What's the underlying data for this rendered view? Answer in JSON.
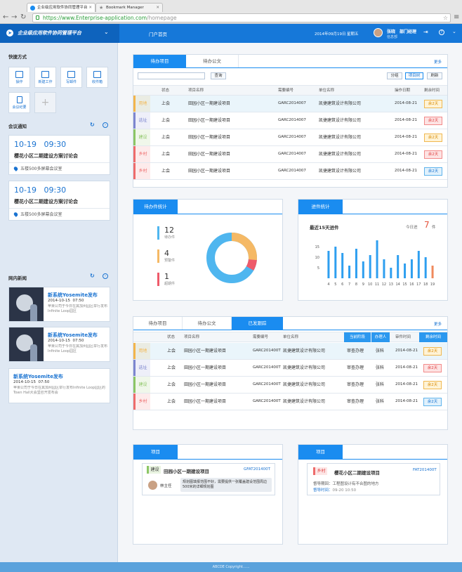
{
  "browser": {
    "tabs": [
      {
        "title": "企业级应用软件协同管理平台",
        "active": true
      },
      {
        "title": "Bookmark Manager",
        "active": false
      }
    ],
    "url_host": "https://www.Enterprise-application.com",
    "url_path": "/homepage"
  },
  "topbar": {
    "app_title": "企业级应用软件协同管理平台",
    "nav_home": "门户首页",
    "date": "2014年09月19日",
    "weekday": "星期五",
    "user_name": "张晓",
    "user_role": "部门经理",
    "user_dept": "信息部"
  },
  "sidebar": {
    "quick_title": "快捷方式",
    "quick": [
      {
        "label": "操作",
        "icon": "monitor-icon"
      },
      {
        "label": "新建工作",
        "icon": "new-doc-icon"
      },
      {
        "label": "写邮件",
        "icon": "mail-icon"
      },
      {
        "label": "收件箱",
        "icon": "inbox-icon"
      },
      {
        "label": "会议纪要",
        "icon": "notes-icon"
      }
    ],
    "meeting_title": "会议通知",
    "meetings": [
      {
        "date": "10-19",
        "time": "09:30",
        "name": "樱花小区二期建设方案讨论会",
        "location": "五楼500多屏幕会议室"
      },
      {
        "date": "10-19",
        "time": "09:30",
        "name": "樱花小区二期建设方案讨论会",
        "location": "五楼500多屏幕会议室"
      }
    ],
    "news_title": "网内新闻",
    "news": [
      {
        "title": "新系统Yosemite发布",
        "date": "2014-10-15",
        "time": "07:50",
        "text": "苹果公司于今日在其加州园区举行发布Infinite Loop园区"
      },
      {
        "title": "新系统Yosemite发布",
        "date": "2014-10-15",
        "time": "07:50",
        "text": "苹果公司于今日在其加州园区举行发布Infinite Loop园区"
      },
      {
        "title": "新系统Yosemite发布",
        "date": "2014-10-15",
        "time": "07:50",
        "text": "苹果公司于今日在其加州园区举行发布Infinite Loop园区的Town Hall大会堂召开发布会"
      }
    ]
  },
  "todo": {
    "tabs": [
      "待办项目",
      "待办公文"
    ],
    "more": "更多",
    "search_btn": "查询",
    "buttons": [
      "分组",
      "项目树",
      "刷新"
    ],
    "headers": [
      "状态",
      "项目名称",
      "需要编号",
      "单位名称",
      "操作日期",
      "剩余时间"
    ],
    "rows": [
      {
        "tag": "用地",
        "tag_color": "#f3b54a",
        "status": "上会",
        "project": "田园小区一期建设项目",
        "code": "GARC2014007",
        "company": "凯捷建筑设计有限公司",
        "date": "2014-08-21",
        "remain": "余2天",
        "remain_type": "yellow"
      },
      {
        "tag": "选址",
        "tag_color": "#7d86cf",
        "status": "上会",
        "project": "田园小区一期建设项目",
        "code": "GARC2014007",
        "company": "凯捷建筑设计有限公司",
        "date": "2014-08-21",
        "remain": "余2天",
        "remain_type": "red"
      },
      {
        "tag": "建设",
        "tag_color": "#8cc665",
        "status": "上会",
        "project": "田园小区一期建设项目",
        "code": "GARC2014007",
        "company": "凯捷建筑设计有限公司",
        "date": "2014-08-21",
        "remain": "余2天",
        "remain_type": "yellow"
      },
      {
        "tag": "乡村",
        "tag_color": "#ee6b6b",
        "status": "上会",
        "project": "田园小区一期建设项目",
        "code": "GARC2014007",
        "company": "凯捷建筑设计有限公司",
        "date": "2014-08-21",
        "remain": "余2天",
        "remain_type": "red"
      },
      {
        "tag": "乡村",
        "tag_color": "#ee6b6b",
        "status": "上会",
        "project": "田园小区一期建设项目",
        "code": "GARC2014007",
        "company": "凯捷建筑设计有限公司",
        "date": "2014-08-21",
        "remain": "余2天",
        "remain_type": "blue"
      }
    ]
  },
  "stats": {
    "title": "待办件统计",
    "items": [
      {
        "num": "12",
        "label": "待办件",
        "color": "#4fb6ef"
      },
      {
        "num": "4",
        "label": "预警件",
        "color": "#f5b965"
      },
      {
        "num": "1",
        "label": "超期件",
        "color": "#ee5a6a"
      }
    ],
    "colors": {
      "ring_blue": "#4fb6ef",
      "ring_yellow": "#f5b965",
      "ring_red": "#ee5a6a"
    }
  },
  "progress": {
    "title": "进件统计",
    "subtitle": "最近15天进件",
    "today_label": "今日进",
    "today_num": "7",
    "today_unit": "件"
  },
  "chart_data": {
    "type": "bar",
    "title": "最近15天进件",
    "categories": [
      "4",
      "5",
      "6",
      "7",
      "8",
      "9",
      "10",
      "11",
      "12",
      "13",
      "14",
      "15",
      "16",
      "17",
      "18",
      "19"
    ],
    "values": [
      13,
      15,
      12,
      6,
      14,
      8,
      11,
      18,
      9,
      5,
      11,
      7,
      9,
      13,
      10,
      6
    ],
    "highlight_last": true,
    "ylim": [
      0,
      20
    ],
    "yticks": [
      5,
      10,
      15
    ],
    "colors": {
      "bar": "#2e9ff0",
      "last": "#f08a5d"
    }
  },
  "tracking": {
    "tabs": [
      "待办项目",
      "待办公文",
      "已发跟踪"
    ],
    "more": "更多",
    "headers": [
      "状态",
      "项目名称",
      "需要编号",
      "单位名称",
      "当前阶段",
      "办理人",
      "审件时间",
      "剩余时间"
    ],
    "rows": [
      {
        "tag": "用地",
        "tag_color": "#f3b54a",
        "status": "上会",
        "project": "田园小区一期建设项目",
        "code": "GARC201400T",
        "company": "凯捷建筑设计有限公司",
        "stage": "审查办理",
        "person": "张科",
        "date": "2014-08-21",
        "remain": "余2天",
        "remain_type": "yellow"
      },
      {
        "tag": "选址",
        "tag_color": "#7d86cf",
        "status": "上会",
        "project": "田园小区一期建设项目",
        "code": "GARC201400T",
        "company": "凯捷建筑设计有限公司",
        "stage": "审查办理",
        "person": "张科",
        "date": "2014-08-21",
        "remain": "余2天",
        "remain_type": "red"
      },
      {
        "tag": "建设",
        "tag_color": "#8cc665",
        "status": "上会",
        "project": "田园小区一期建设项目",
        "code": "GARC201400T",
        "company": "凯捷建筑设计有限公司",
        "stage": "审查办理",
        "person": "张科",
        "date": "2014-08-21",
        "remain": "余2天",
        "remain_type": "yellow"
      },
      {
        "tag": "乡村",
        "tag_color": "#ee6b6b",
        "status": "上会",
        "project": "田园小区一期建设项目",
        "code": "GARC201400T",
        "company": "凯捷建筑设计有限公司",
        "stage": "审查办理",
        "person": "张科",
        "date": "2014-08-21",
        "remain": "余2天",
        "remain_type": "blue"
      }
    ]
  },
  "project1": {
    "title": "项目",
    "tag": "建设",
    "name": "田园小区一期建设项目",
    "code": "GFAT201400T",
    "person": "林主任",
    "comment": "规划图填报范围不好，需要提供一张覆盖建设范围周边500米的详细规划图"
  },
  "project2": {
    "title": "项目",
    "tag": "乡村",
    "name": "樱花小区二期建设项目",
    "code": "FAT201400T",
    "line1": "督导期回：工程图设计有不合图的地方",
    "line2_label": "督导时间：",
    "line2_time": "09-20 10:50"
  },
  "footer": {
    "text": "ABCDE Copyright......"
  }
}
